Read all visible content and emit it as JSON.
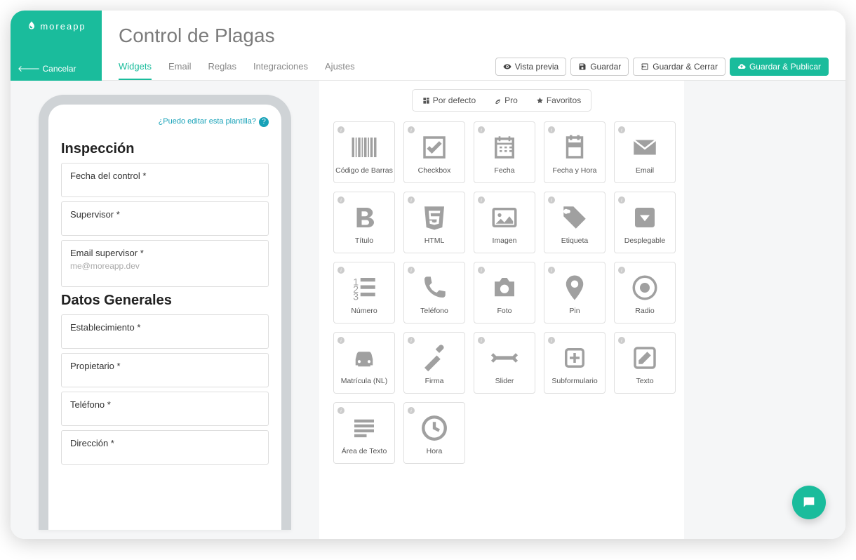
{
  "brand": "moreapp",
  "cancel": "🡐 Cancelar",
  "title": "Control de Plagas",
  "tabs": [
    "Widgets",
    "Email",
    "Reglas",
    "Integraciones",
    "Ajustes"
  ],
  "actions": {
    "preview": "Vista previa",
    "save": "Guardar",
    "save_close": "Guardar & Cerrar",
    "save_publish": "Guardar & Publicar"
  },
  "preview": {
    "hint": "¿Puedo editar esta plantilla?",
    "sections": [
      {
        "heading": "Inspección",
        "fields": [
          {
            "label": "Fecha del control *"
          },
          {
            "label": "Supervisor *"
          },
          {
            "label": "Email supervisor *",
            "placeholder": "me@moreapp.dev"
          }
        ]
      },
      {
        "heading": "Datos Generales",
        "fields": [
          {
            "label": "Establecimiento *"
          },
          {
            "label": "Propietario *"
          },
          {
            "label": "Teléfono *"
          },
          {
            "label": "Dirección *"
          }
        ]
      }
    ]
  },
  "filters": {
    "default": "Por defecto",
    "pro": "Pro",
    "favorites": "Favoritos"
  },
  "widgets": [
    {
      "key": "barcode",
      "label": "Código de Barras"
    },
    {
      "key": "checkbox",
      "label": "Checkbox"
    },
    {
      "key": "date",
      "label": "Fecha"
    },
    {
      "key": "datetime",
      "label": "Fecha y Hora"
    },
    {
      "key": "email",
      "label": "Email"
    },
    {
      "key": "title",
      "label": "Título"
    },
    {
      "key": "html",
      "label": "HTML"
    },
    {
      "key": "image",
      "label": "Imagen"
    },
    {
      "key": "tag",
      "label": "Etiqueta"
    },
    {
      "key": "dropdown",
      "label": "Desplegable"
    },
    {
      "key": "number",
      "label": "Número"
    },
    {
      "key": "phone",
      "label": "Teléfono"
    },
    {
      "key": "photo",
      "label": "Foto"
    },
    {
      "key": "pin",
      "label": "Pin"
    },
    {
      "key": "radio",
      "label": "Radio"
    },
    {
      "key": "plate",
      "label": "Matrícula (NL)"
    },
    {
      "key": "signature",
      "label": "Firma"
    },
    {
      "key": "slider",
      "label": "Slider"
    },
    {
      "key": "subform",
      "label": "Subformulario"
    },
    {
      "key": "text",
      "label": "Texto"
    },
    {
      "key": "textarea",
      "label": "Área de Texto"
    },
    {
      "key": "time",
      "label": "Hora"
    }
  ]
}
